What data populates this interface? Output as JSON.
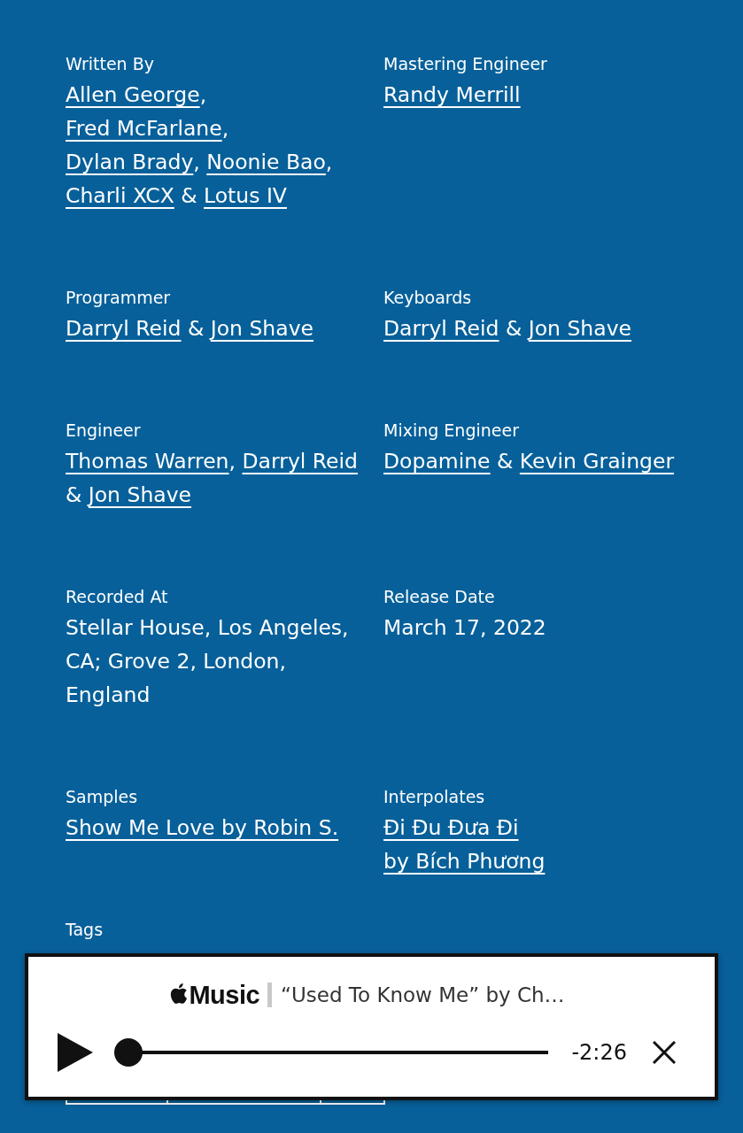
{
  "credits": [
    {
      "label": "Written By",
      "parts": [
        {
          "kind": "link",
          "text": "Allen George"
        },
        {
          "kind": "text",
          "text": ", "
        },
        {
          "kind": "link",
          "text": "Fred McFarlane"
        },
        {
          "kind": "text",
          "text": ", "
        },
        {
          "kind": "link",
          "text": "Dylan Brady"
        },
        {
          "kind": "text",
          "text": ", "
        },
        {
          "kind": "link",
          "text": "Noonie Bao"
        },
        {
          "kind": "text",
          "text": ", "
        },
        {
          "kind": "link",
          "text": "Charli XCX"
        },
        {
          "kind": "text",
          "text": " & "
        },
        {
          "kind": "link",
          "text": "Lotus IV"
        }
      ]
    },
    {
      "label": "Mastering Engineer",
      "parts": [
        {
          "kind": "link",
          "text": "Randy Merrill"
        }
      ]
    },
    {
      "label": "Programmer",
      "parts": [
        {
          "kind": "link",
          "text": "Darryl Reid"
        },
        {
          "kind": "text",
          "text": " & "
        },
        {
          "kind": "link",
          "text": "Jon Shave"
        }
      ]
    },
    {
      "label": "Keyboards",
      "parts": [
        {
          "kind": "link",
          "text": "Darryl Reid"
        },
        {
          "kind": "text",
          "text": " & "
        },
        {
          "kind": "link",
          "text": "Jon Shave"
        }
      ]
    },
    {
      "label": "Engineer",
      "parts": [
        {
          "kind": "link",
          "text": "Thomas Warren"
        },
        {
          "kind": "text",
          "text": ", "
        },
        {
          "kind": "link",
          "text": "Darryl Reid"
        },
        {
          "kind": "text",
          "text": " & "
        },
        {
          "kind": "link",
          "text": "Jon Shave"
        }
      ]
    },
    {
      "label": "Mixing Engineer",
      "parts": [
        {
          "kind": "link",
          "text": "Dopamine"
        },
        {
          "kind": "text",
          "text": " & "
        },
        {
          "kind": "link",
          "text": "Kevin Grainger"
        }
      ]
    },
    {
      "label": "Recorded At",
      "parts": [
        {
          "kind": "text",
          "text": "Stellar House, Los Angeles, CA; Grove 2, London, England"
        }
      ]
    },
    {
      "label": "Release Date",
      "parts": [
        {
          "kind": "text",
          "text": "March 17, 2022"
        }
      ]
    },
    {
      "label": "Samples",
      "parts": [
        {
          "kind": "link",
          "text": "Show Me Love by Robin S."
        }
      ]
    },
    {
      "label": "Interpolates",
      "parts": [
        {
          "kind": "link",
          "text": "Đi Đu Đưa Đi\nby Bích Phương"
        }
      ]
    }
  ],
  "tags": {
    "label": "Tags"
  },
  "player": {
    "service": "Music",
    "title": "“Used To Know Me” by Ch…",
    "progress": {
      "level": 0
    },
    "time": "-2:26"
  }
}
